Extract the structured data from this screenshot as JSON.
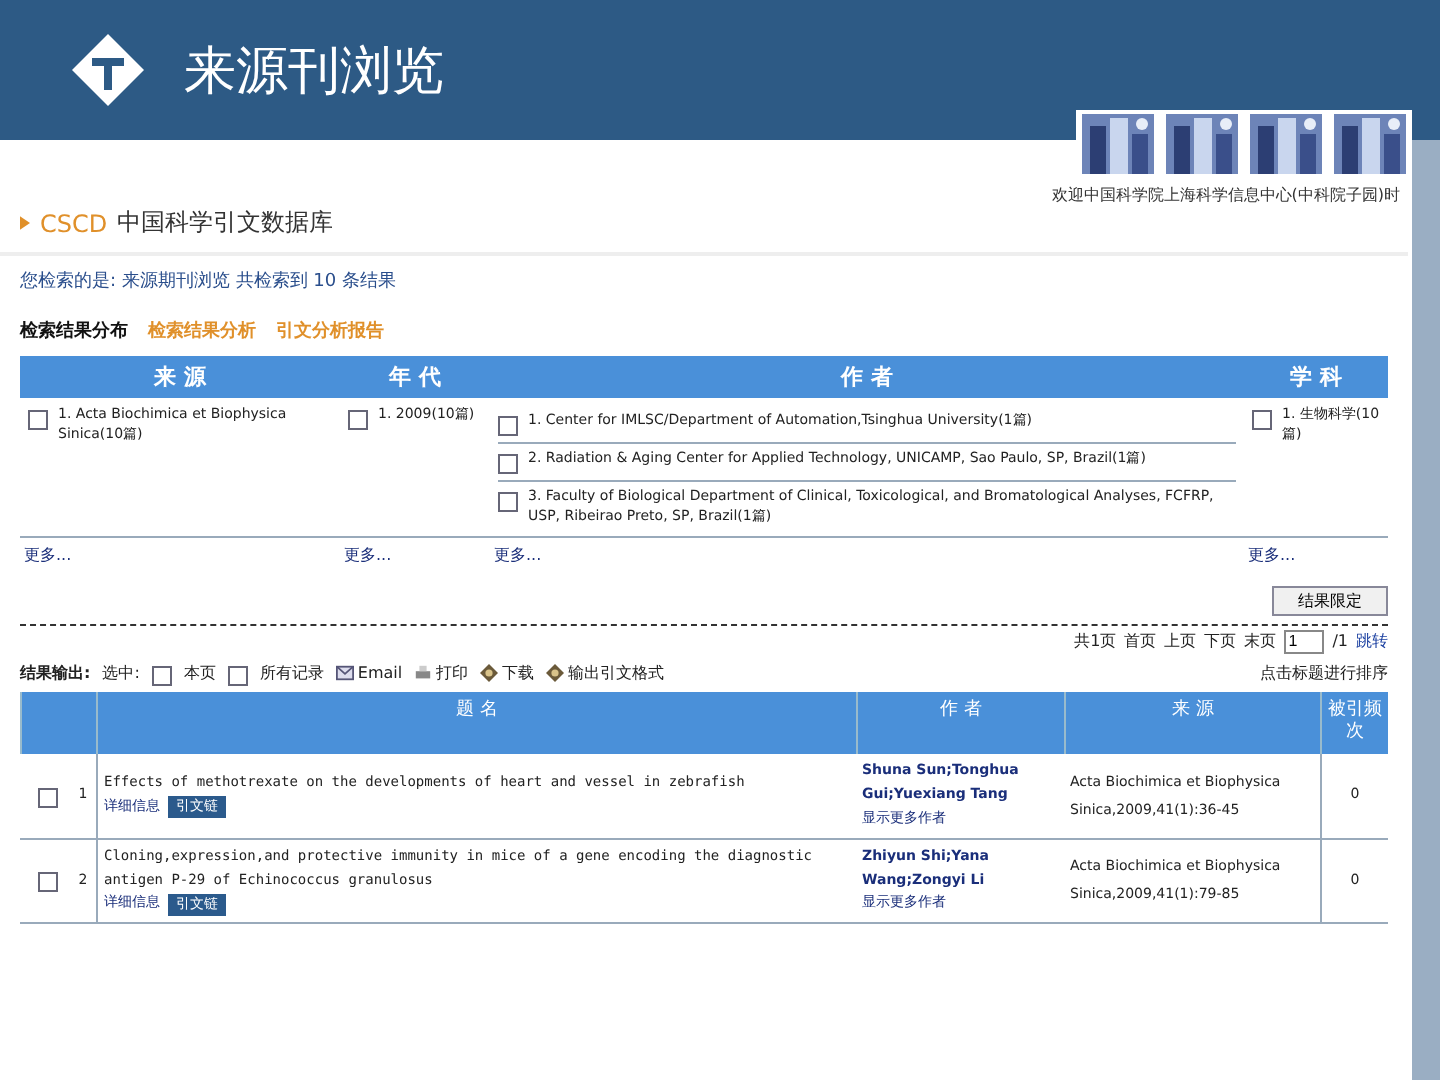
{
  "header": {
    "title": "来源刊浏览",
    "welcome": "欢迎中国科学院上海科学信息中心(中科院子园)时"
  },
  "site": {
    "brand": "CSCD",
    "name": "中国科学引文数据库"
  },
  "summary": "您检索的是:  来源期刊浏览  共检索到 10 条结果",
  "analysis_tabs": [
    {
      "label": "检索结果分布",
      "selected": true
    },
    {
      "label": "检索结果分析",
      "selected": false
    },
    {
      "label": "引文分析报告",
      "selected": false
    }
  ],
  "facets": {
    "columns": [
      "来 源",
      "年 代",
      "作 者",
      "学 科"
    ],
    "source": [
      {
        "label": "1. Acta Biochimica et Biophysica Sinica(10篇)",
        "checked": false
      }
    ],
    "year": [
      {
        "label": "1. 2009(10篇)",
        "checked": false
      }
    ],
    "author": [
      {
        "label": "1. Center for IMLSC/Department of Automation,Tsinghua University(1篇)",
        "checked": false
      },
      {
        "label": "2. Radiation & Aging Center for Applied Technology, UNICAMP, Sao Paulo, SP, Brazil(1篇)",
        "checked": false
      },
      {
        "label": "3. Faculty of Biological Department of Clinical, Toxicological, and Bromatological Analyses, FCFRP, USP, Ribeirao Preto, SP, Brazil(1篇)",
        "checked": false
      }
    ],
    "subject": [
      {
        "label": "1. 生物科学(10篇)",
        "checked": false
      }
    ],
    "more": [
      "更多...",
      "更多...",
      "更多...",
      "更多..."
    ]
  },
  "limit_button": "结果限定",
  "pager": {
    "items": [
      "共1页",
      "首页",
      "上页",
      "下页",
      "末页"
    ],
    "page": "1",
    "total": "/1",
    "go": "跳转"
  },
  "output": {
    "label": "结果输出:",
    "select": "选中:",
    "options": [
      {
        "label": "本页",
        "checked": false
      },
      {
        "label": "所有记录",
        "checked": false
      }
    ],
    "actions": [
      {
        "kind": "mail",
        "label": "Email"
      },
      {
        "kind": "print",
        "label": "打印"
      },
      {
        "kind": "download",
        "label": "下载"
      },
      {
        "kind": "export",
        "label": "输出引文格式"
      }
    ]
  },
  "sort_hint": "点击标题进行排序",
  "results": {
    "columns": [
      "题 名",
      "作 者",
      "来 源",
      "被引频次"
    ],
    "rows": [
      {
        "checked": false,
        "index": "1",
        "title": "Effects of methotrexate on the developments of heart and vessel in zebrafish",
        "detail": "详细信息",
        "cite_badge": "引文链",
        "authors": "Shuna Sun;Tonghua Gui;Yuexiang Tang",
        "more_authors": "显示更多作者",
        "source": "Acta Biochimica et Biophysica Sinica,2009,41(1):36-45",
        "cited": "0"
      },
      {
        "checked": false,
        "index": "2",
        "title": "Cloning,expression,and protective immunity in mice of a gene encoding the diagnostic antigen P-29 of Echinococcus granulosus",
        "detail": "详细信息",
        "cite_badge": "引文链",
        "authors": "Zhiyun Shi;Yana Wang;Zongyi Li",
        "more_authors": "显示更多作者",
        "source": "Acta Biochimica et Biophysica Sinica,2009,41(1):79-85",
        "cited": "0"
      }
    ]
  }
}
